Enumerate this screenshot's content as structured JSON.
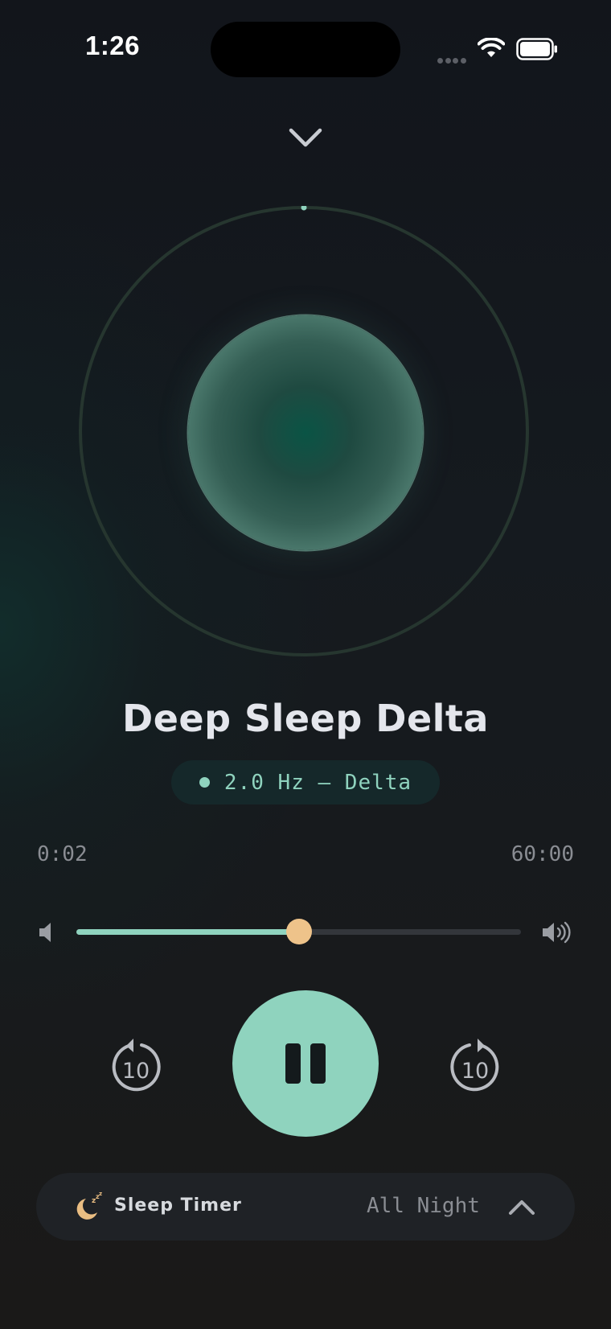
{
  "status_bar": {
    "time": "1:26"
  },
  "player": {
    "title": "Deep Sleep Delta",
    "frequency_badge": "2.0 Hz — Delta",
    "accent_color": "#8fd3be",
    "thumb_color": "#eec38a",
    "time_elapsed": "0:02",
    "time_total": "60:00",
    "progress_fraction": 0.0006,
    "volume_fraction": 0.5,
    "skip_back_seconds": "10",
    "skip_forward_seconds": "10",
    "state": "playing"
  },
  "sleep_timer": {
    "label": "Sleep Timer",
    "value": "All Night"
  },
  "icons": {
    "collapse": "chevron-down-icon",
    "volume_low": "speaker-low-icon",
    "volume_high": "speaker-high-icon",
    "skip_back": "rewind-10-icon",
    "skip_forward": "forward-10-icon",
    "pause": "pause-icon",
    "timer": "moon-zzz-icon",
    "expand": "chevron-up-icon"
  }
}
